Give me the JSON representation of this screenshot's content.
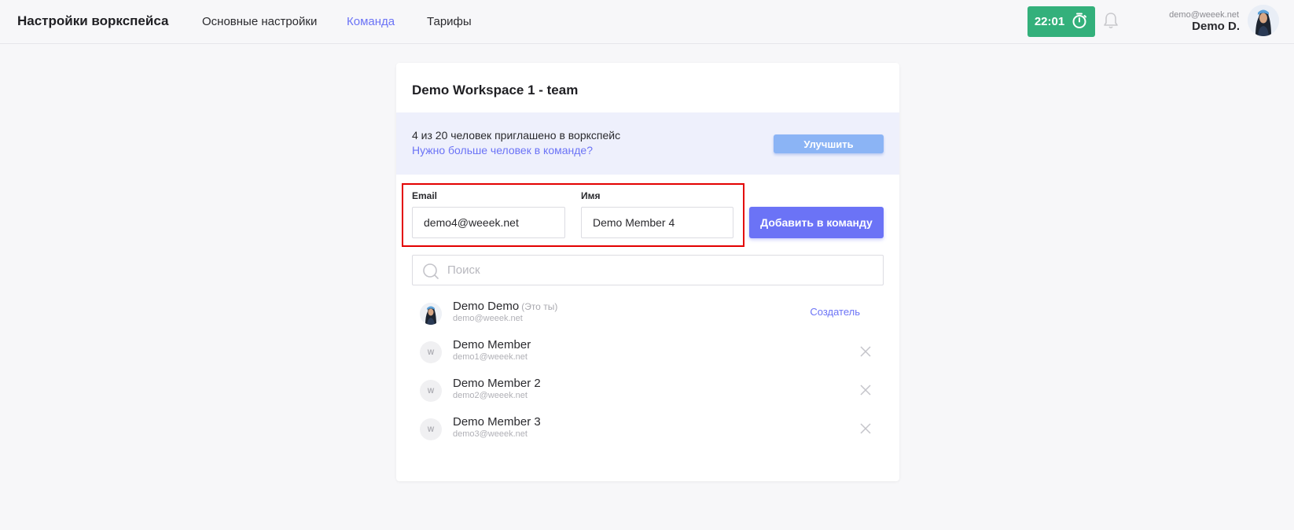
{
  "header": {
    "title": "Настройки воркспейса",
    "tabs": [
      {
        "label": "Основные настройки",
        "active": false
      },
      {
        "label": "Команда",
        "active": true
      },
      {
        "label": "Тарифы",
        "active": false
      }
    ],
    "timer": "22:01",
    "user_email": "demo@weeek.net",
    "user_name": "Demo D."
  },
  "card": {
    "title": "Demo Workspace 1 - team",
    "banner_text": "4 из 20 человек приглашено в воркспейс",
    "banner_link": "Нужно больше человек в команде?",
    "upgrade_label": "Улучшить",
    "email_label": "Email",
    "email_value": "demo4@weeek.net",
    "name_label": "Имя",
    "name_value": "Demo Member 4",
    "add_label": "Добавить в команду",
    "search_placeholder": "Поиск"
  },
  "members": [
    {
      "name": "Demo Demo",
      "tag": "(Это ты)",
      "email": "demo@weeek.net",
      "role": "Создатель",
      "avatar": "photo"
    },
    {
      "name": "Demo Member",
      "tag": "",
      "email": "demo1@weeek.net",
      "role": "",
      "avatar": "W"
    },
    {
      "name": "Demo Member 2",
      "tag": "",
      "email": "demo2@weeek.net",
      "role": "",
      "avatar": "W"
    },
    {
      "name": "Demo Member 3",
      "tag": "",
      "email": "demo3@weeek.net",
      "role": "",
      "avatar": "W"
    }
  ],
  "colors": {
    "accent": "#6b73f6",
    "timer_bg": "#33b07b",
    "highlight": "#e30000",
    "upgrade_bg": "#8bb4f5"
  }
}
